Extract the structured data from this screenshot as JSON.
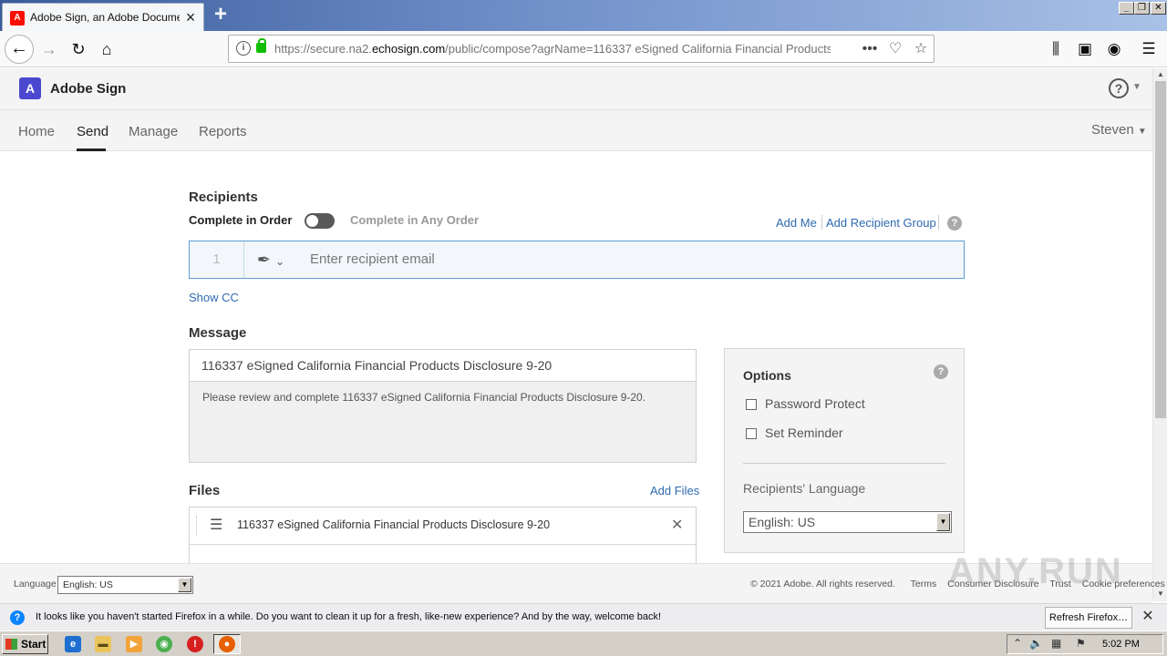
{
  "browser": {
    "tab_title": "Adobe Sign, an Adobe Document Cloud",
    "tab_favicon_letter": "A",
    "new_tab": "+",
    "url_prefix": "https://secure.na2.",
    "url_domain": "echosign.com",
    "url_rest": "/public/compose?agrName=116337 eSigned California Financial Products",
    "window_buttons": [
      "_",
      "❐",
      "✕"
    ]
  },
  "app": {
    "logo_letter": "A",
    "title": "Adobe Sign",
    "nav": {
      "home": "Home",
      "send": "Send",
      "manage": "Manage",
      "reports": "Reports"
    },
    "user": "Steven"
  },
  "recipients": {
    "title": "Recipients",
    "complete_in_order": "Complete in Order",
    "complete_any_order": "Complete in Any Order",
    "add_me": "Add Me",
    "add_group": "Add Recipient Group",
    "row_number": "1",
    "email_placeholder": "Enter recipient email",
    "show_cc": "Show CC"
  },
  "message": {
    "title": "Message",
    "subject": "116337 eSigned California Financial Products Disclosure 9-20",
    "body": "Please review and complete 116337 eSigned California Financial Products Disclosure 9-20."
  },
  "options": {
    "title": "Options",
    "password_protect": "Password Protect",
    "set_reminder": "Set Reminder",
    "language_label": "Recipients' Language",
    "language_value": "English: US"
  },
  "files": {
    "title": "Files",
    "add_files": "Add Files",
    "items": [
      {
        "name": "116337 eSigned California Financial Products Disclosure 9-20"
      }
    ]
  },
  "footer": {
    "language_label": "Language",
    "language_value": "English: US",
    "copyright": "© 2021 Adobe. All rights reserved.",
    "terms": "Terms",
    "consumer_disclosure": "Consumer Disclosure",
    "trust": "Trust",
    "cookie_preferences": "Cookie preferences",
    "watermark": "ANY.RUN"
  },
  "notification": {
    "text": "It looks like you haven't started Firefox in a while. Do you want to clean it up for a fresh, like-new experience? And by the way, welcome back!",
    "button": "Refresh Firefox…"
  },
  "taskbar": {
    "start": "Start",
    "clock": "5:02 PM"
  },
  "colors": {
    "accent_link": "#2d6ab0",
    "adobe_logo": "#4b48d0",
    "recipient_border": "#5c9bd6"
  }
}
